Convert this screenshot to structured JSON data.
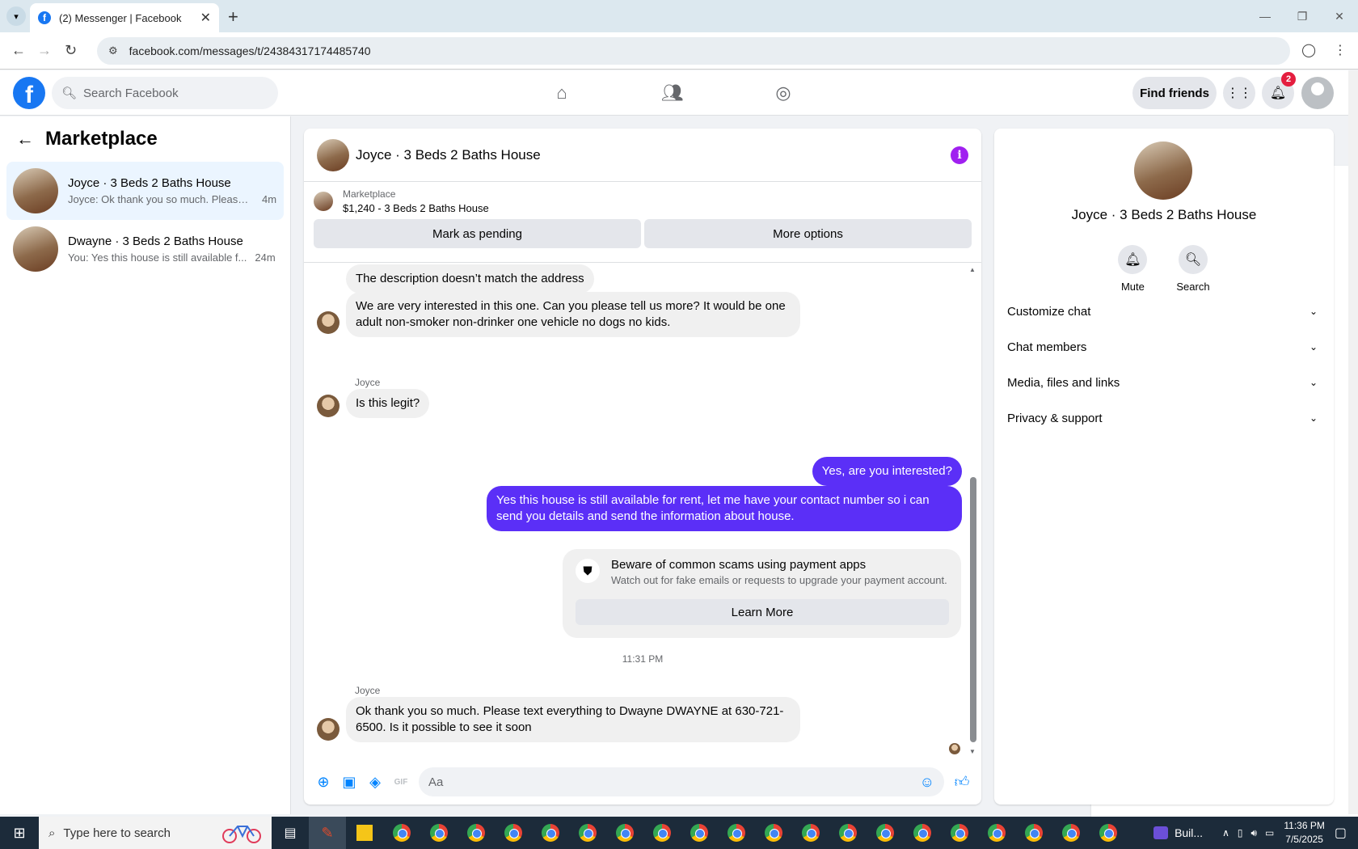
{
  "browser": {
    "tab_title": "(2) Messenger | Facebook",
    "url": "facebook.com/messages/t/24384317174485740"
  },
  "fb_header": {
    "search_placeholder": "Search Facebook",
    "find_friends": "Find friends",
    "notif_count": "2"
  },
  "sidebar": {
    "title": "Marketplace",
    "conversations": [
      {
        "name": "Joyce · 3 Beds 2 Baths House",
        "preview": "Joyce: Ok thank you so much. Please ...",
        "time": "4m"
      },
      {
        "name": "Dwayne · 3 Beds 2 Baths House",
        "preview": "You: Yes this house is still available f...",
        "time": "24m"
      }
    ]
  },
  "chat": {
    "title": "Joyce · 3 Beds 2 Baths House",
    "marketplace_label": "Marketplace",
    "listing": "$1,240 - 3 Beds 2 Baths House",
    "mark_pending": "Mark as pending",
    "more_options": "More options",
    "messages": {
      "m1": "The description doesn’t match the address",
      "m2": "We are very interested in this one. Can you please tell us more? It would be one adult non-smoker non-drinker one vehicle no dogs no kids.",
      "sender1": "Joyce",
      "m3": "Is this legit?",
      "m4": "Yes, are you interested?",
      "m5": "Yes this house is still available for rent, let me have your contact number so i can send you details and send the information about house.",
      "timestamp": "11:31 PM",
      "sender2": "Joyce",
      "m6": "Ok thank you so much. Please text everything to Dwayne DWAYNE at 630-721-6500. Is it possible to see it soon"
    },
    "scam_notice": {
      "title": "Beware of common scams using payment apps",
      "subtitle": "Watch out for fake emails or requests to upgrade your payment account.",
      "button": "Learn More"
    },
    "composer_placeholder": "Aa"
  },
  "details": {
    "name": "Joyce · 3 Beds 2 Baths House",
    "mute": "Mute",
    "search": "Search",
    "sections": [
      "Customize chat",
      "Chat members",
      "Media, files and links",
      "Privacy & support"
    ]
  },
  "taskbar": {
    "search_placeholder": "Type here to search",
    "app_label": "Buil...",
    "time": "11:36 PM",
    "date": "7/5/2025"
  },
  "colors": {
    "accent": "#5b2ff7",
    "fb_blue": "#1877f2",
    "info_purple": "#a020f0"
  }
}
